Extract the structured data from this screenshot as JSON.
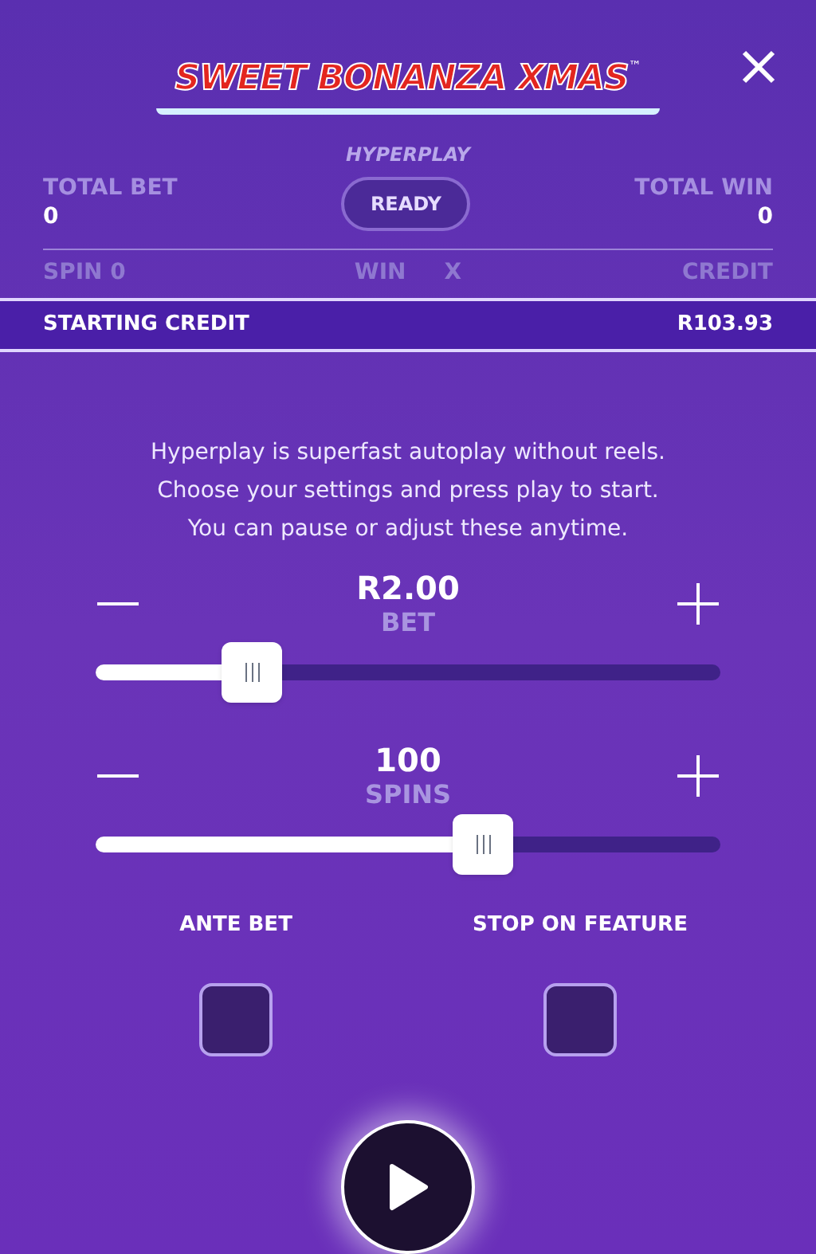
{
  "logo": {
    "text": "SWEET BONANZA XMAS",
    "trademark": "™"
  },
  "mode_label": "HYPERPLAY",
  "status_button": "READY",
  "totals": [
    {
      "label": "TOTAL BET",
      "value": "0"
    },
    {
      "label": "TOTAL WIN",
      "value": "0"
    }
  ],
  "info_row": {
    "spin": "SPIN 0",
    "win": "WIN",
    "multiplier": "X",
    "credit": "CREDIT"
  },
  "starting_credit": {
    "label": "STARTING CREDIT",
    "value": "R103.93"
  },
  "description": [
    "Hyperplay is superfast autoplay without reels.",
    "Choose your settings and press play to start.",
    "You can pause or adjust these anytime."
  ],
  "sliders": [
    {
      "value": "R2.00",
      "label": "BET",
      "level": 0.25
    },
    {
      "value": "100",
      "label": "SPINS",
      "level": 0.62
    }
  ],
  "options": [
    {
      "label": "ANTE BET",
      "checked": false
    },
    {
      "label": "STOP ON FEATURE",
      "checked": false
    }
  ]
}
